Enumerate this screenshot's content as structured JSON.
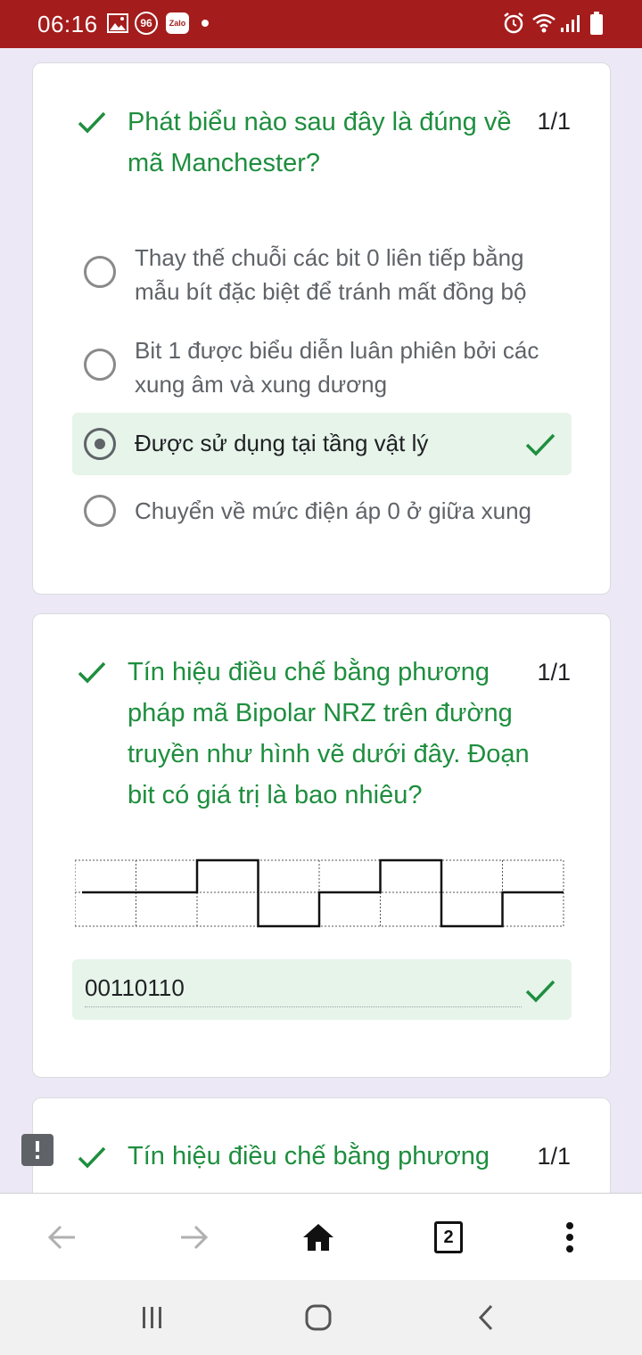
{
  "status_bar": {
    "time": "06:16",
    "left_icons": [
      "image-icon",
      "badge-96-icon",
      "zalo-icon",
      "dot-icon"
    ],
    "badge_text": "96",
    "zalo_text": "Zalo",
    "right_icons": [
      "alarm-icon",
      "wifi-icon",
      "signal-icon",
      "battery-icon"
    ]
  },
  "questions": [
    {
      "text": "Phát biểu nào sau đây là đúng về mã Manchester?",
      "score": "1/1",
      "status": "correct",
      "options": [
        {
          "label": "Thay thế chuỗi các bit 0 liên tiếp bằng mẫu bít đặc biệt để tránh mất đồng bộ",
          "selected": false
        },
        {
          "label": "Bit 1 được biểu diễn luân phiên bởi các xung âm và xung dương",
          "selected": false
        },
        {
          "label": "Được sử dụng tại tầng vật lý",
          "selected": true
        },
        {
          "label": "Chuyển về mức điện áp 0 ở giữa xung",
          "selected": false
        }
      ]
    },
    {
      "text": "Tín hiệu điều chế bằng phương pháp mã Bipolar NRZ trên đường truyền như hình vẽ dưới đây. Đoạn bit có giá trị là bao nhiêu?",
      "score": "1/1",
      "status": "correct",
      "signal_levels": [
        0,
        0,
        1,
        -1,
        0,
        1,
        -1,
        0
      ],
      "answer": "00110110"
    },
    {
      "text": "Tín hiệu điều chế bằng phương",
      "score": "1/1",
      "status": "correct"
    }
  ],
  "browser_nav": {
    "icons": [
      "back-icon",
      "forward-icon",
      "home-icon",
      "tabs-icon",
      "menu-icon"
    ],
    "tab_count": "2"
  },
  "system_nav": {
    "icons": [
      "recent-apps-icon",
      "home-button-icon",
      "back-button-icon"
    ]
  },
  "colors": {
    "status_bar": "#a51c1c",
    "correct_green": "#1e8e3e",
    "selected_bg": "#e6f4ea",
    "page_bg": "#ece8f5"
  }
}
